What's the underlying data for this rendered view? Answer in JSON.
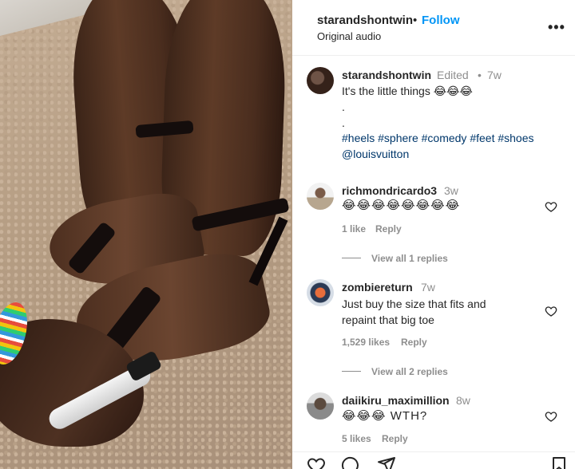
{
  "header": {
    "username": "starandshontwin",
    "separator": "•",
    "follow_label": "Follow",
    "audio_label": "Original audio",
    "more_icon": "more-horizontal-icon",
    "more_glyph": "•••"
  },
  "post": {
    "username": "starandshontwin",
    "edited_label": "Edited",
    "separator": "•",
    "age": "7w",
    "caption": "It's the little things 😂😂😂",
    "dot_line_1": ".",
    "dot_line_2": ".",
    "hashtags": "#heels #sphere #comedy #feet #shoes",
    "mention": "@louisvuitton"
  },
  "comments": [
    {
      "username": "richmondricardo3",
      "age": "3w",
      "text": "😂😂😂😂😂😂😂😂",
      "likes_label": "1 like",
      "reply_label": "Reply",
      "view_replies_label": "View all 1 replies"
    },
    {
      "username": "zombiereturn",
      "age": "7w",
      "text": "Just buy the size that fits and\nrepaint that big toe",
      "likes_label": "1,529 likes",
      "reply_label": "Reply",
      "view_replies_label": "View all 2 replies"
    },
    {
      "username": "daiikiru_maximillion",
      "age": "8w",
      "text": "😂😂😂 WTH?",
      "likes_label": "5 likes",
      "reply_label": "Reply"
    }
  ],
  "actions": {
    "icons": [
      "heart-icon",
      "comment-icon",
      "share-icon",
      "bookmark-icon"
    ]
  }
}
